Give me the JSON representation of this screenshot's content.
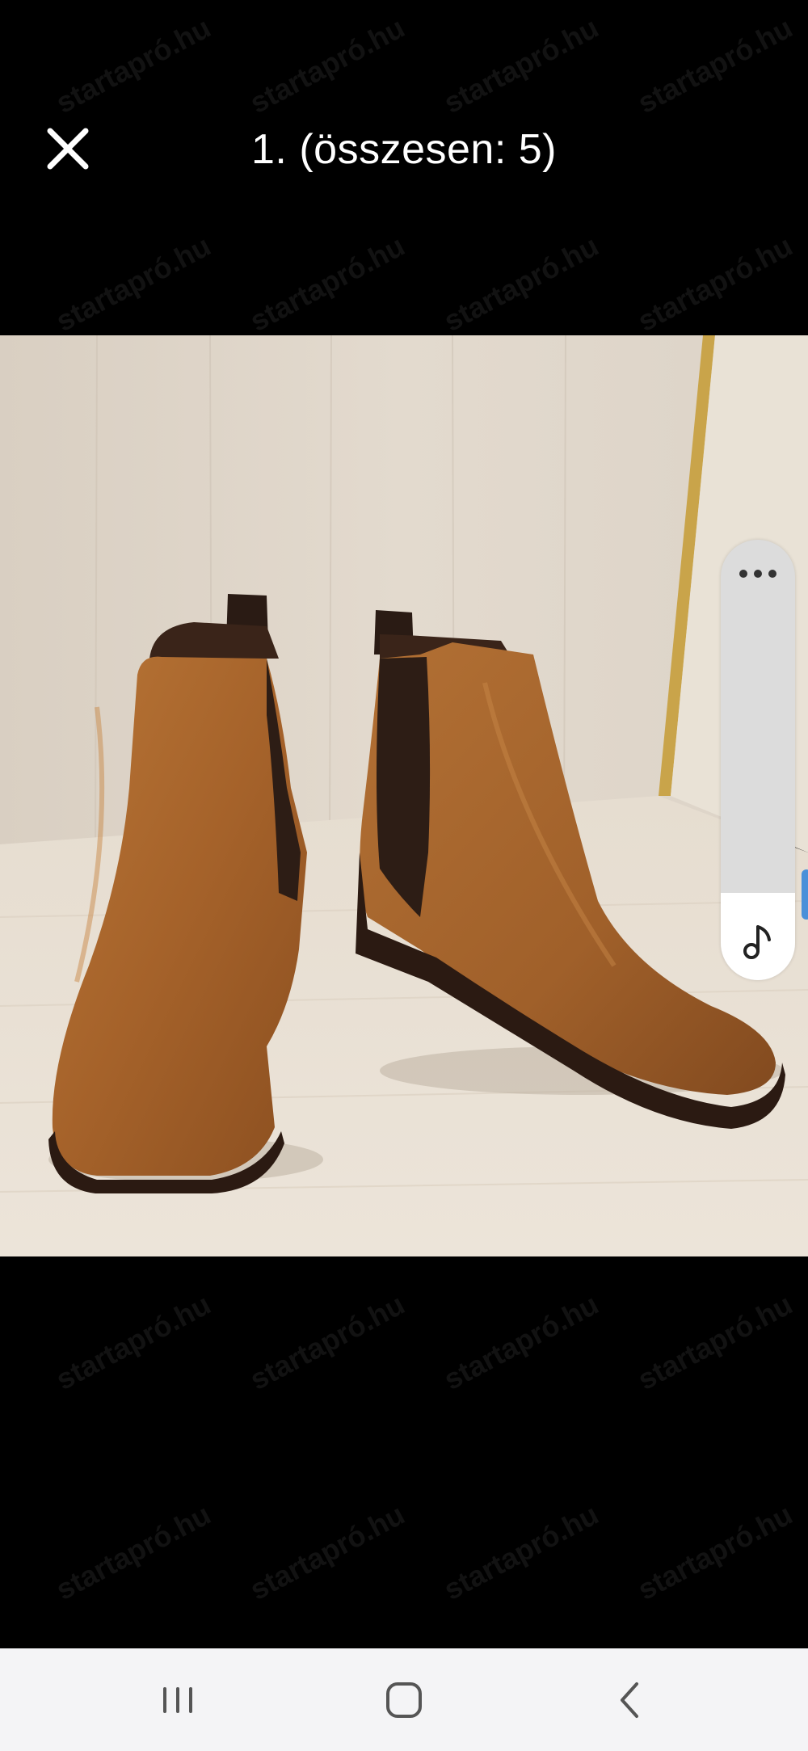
{
  "header": {
    "title": "1. (összesen: 5)",
    "close_icon": "close-icon"
  },
  "watermark": {
    "text": "startapró.hu"
  },
  "image": {
    "subject": "brown leather chelsea boots",
    "index": 1,
    "total": 5
  },
  "side_panel": {
    "more_icon": "more-horizontal-icon",
    "music_icon": "music-note-icon"
  },
  "navbar": {
    "recents_icon": "recents-icon",
    "home_icon": "home-icon",
    "back_icon": "back-icon"
  },
  "colors": {
    "background": "#000000",
    "navbar_bg": "#f4f4f6",
    "panel_bg": "#dcdcdc",
    "leather": "#a8642a"
  }
}
